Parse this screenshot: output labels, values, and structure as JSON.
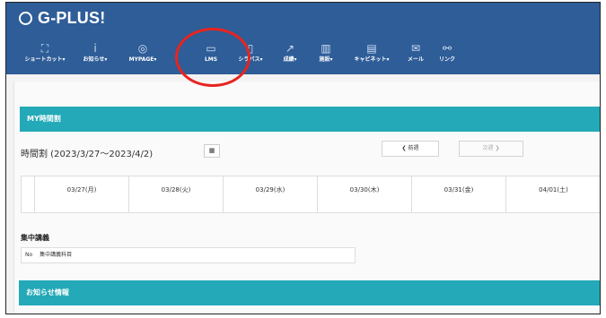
{
  "app": {
    "name": "G-PLUS!"
  },
  "nav": {
    "items": [
      {
        "label": "ショートカット▾",
        "icon": "shortcut-icon",
        "glyph": "⛶"
      },
      {
        "label": "お知らせ▾",
        "icon": "info-icon",
        "glyph": "i"
      },
      {
        "label": "MYPAGE▾",
        "icon": "mypage-icon",
        "glyph": "◎"
      },
      {
        "label": "LMS",
        "icon": "monitor-icon",
        "glyph": "▭"
      },
      {
        "label": "シラバス▾",
        "icon": "syllabus-icon",
        "glyph": "▯"
      },
      {
        "label": "成績▾",
        "icon": "grades-icon",
        "glyph": "↗"
      },
      {
        "label": "施設▾",
        "icon": "facility-icon",
        "glyph": "▥"
      },
      {
        "label": "キャビネット▾",
        "icon": "cabinet-icon",
        "glyph": "▤"
      },
      {
        "label": "メール",
        "icon": "mail-icon",
        "glyph": "✉"
      },
      {
        "label": "リンク",
        "icon": "link-icon",
        "glyph": "⚯"
      }
    ]
  },
  "schedule": {
    "section_title": "MY時間割",
    "title": "時間割 (2023/3/27〜2023/4/2)",
    "calendar_icon": "calendar-icon",
    "calendar_glyph": "▦",
    "prev_week": "❮ 前週",
    "next_week": "次週 ❯",
    "days": [
      "03/27(月)",
      "03/28(火)",
      "03/29(水)",
      "03/30(木)",
      "03/31(金)",
      "04/01(土)"
    ]
  },
  "intensive": {
    "title": "集中講義",
    "col_no": "No",
    "col_subject": "集中講義科目"
  },
  "news": {
    "section_title": "お知らせ情報"
  },
  "annotation": {
    "highlight_color": "#e8241f"
  }
}
